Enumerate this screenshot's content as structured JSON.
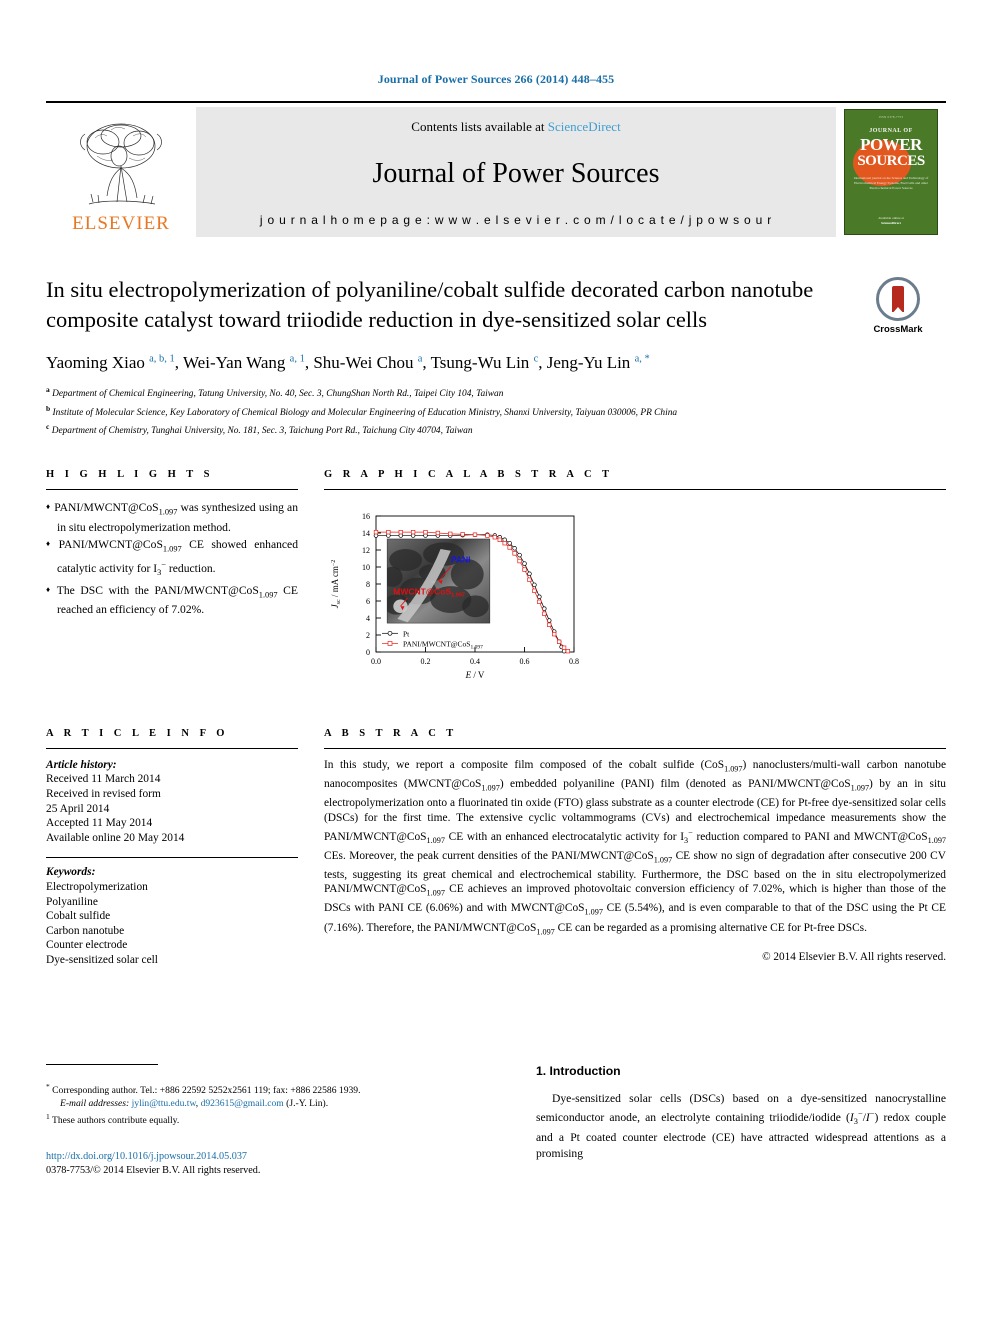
{
  "journal_ref": "Journal of Power Sources 266 (2014) 448–455",
  "masthead": {
    "contents_prefix": "Contents lists available at ",
    "sciencedirect": "ScienceDirect",
    "journal_title": "Journal of Power Sources",
    "homepage": "j o u r n a l   h o m e p a g e :   w w w . e l s e v i e r . c o m / l o c a t e / j p o w s o u r",
    "publisher": "ELSEVIER",
    "cover": {
      "top_line": "ISSN 0378-7753",
      "journal_of": "JOURNAL OF",
      "power": "POWER",
      "sources": "SOURCES",
      "blurb": "International journal on the Science and Technology of Electrochemical Energy Systems, Fuel Cells and other Electrochemical Power Sources",
      "bottom_small": "Available online at",
      "bottom_brand": "ScienceDirect"
    }
  },
  "article": {
    "title": "In situ electropolymerization of polyaniline/cobalt sulfide decorated carbon nanotube composite catalyst toward triiodide reduction in dye-sensitized solar cells",
    "crossmark_label": "CrossMark",
    "authors_html": "Yaoming Xiao <sup>a, b, 1</sup>, Wei-Yan Wang <sup>a, 1</sup>, Shu-Wei Chou <sup>a</sup>, Tsung-Wu Lin <sup>c</sup>, Jeng-Yu Lin <sup>a, <span class=\"blk\">*</span></sup>",
    "affiliations": [
      {
        "marker": "a",
        "text": "Department of Chemical Engineering, Tatung University, No. 40, Sec. 3, ChungShan North Rd., Taipei City 104, Taiwan"
      },
      {
        "marker": "b",
        "text": "Institute of Molecular Science, Key Laboratory of Chemical Biology and Molecular Engineering of Education Ministry, Shanxi University, Taiyuan 030006, PR China"
      },
      {
        "marker": "c",
        "text": "Department of Chemistry, Tunghai University, No. 181, Sec. 3, Taichung Port Rd., Taichung City 40704, Taiwan"
      }
    ]
  },
  "highlights": {
    "heading": "H I G H L I G H T S",
    "items": [
      "PANI/MWCNT@CoS<sub>1.097</sub> was synthesized using an in situ electropolymerization method.",
      "PANI/MWCNT@CoS<sub>1.097</sub> CE showed enhanced catalytic activity for I<sub>3</sub><sup class=\"ovl\">&#8722;</sup> reduction.",
      "The DSC with the PANI/MWCNT@CoS<sub>1.097</sub> CE reached an efficiency of 7.02%."
    ]
  },
  "graphical_abstract": {
    "heading": "G R A P H I C A L   A B S T R A C T",
    "inset_labels": {
      "pani": "PANI",
      "mwcnt": "MWCNT@CoS",
      "mwcnt_sub": "1.097"
    }
  },
  "chart_data": {
    "type": "line",
    "title": "",
    "xlabel": "E / V",
    "ylabel": "J_sc / mA cm^-2",
    "xlim": [
      0.0,
      0.8
    ],
    "ylim": [
      0,
      16
    ],
    "xticks": [
      "0.0",
      "0.2",
      "0.4",
      "0.6",
      "0.8"
    ],
    "yticks": [
      "0",
      "2",
      "4",
      "6",
      "8",
      "10",
      "12",
      "14",
      "16"
    ],
    "grid": false,
    "legend_position": "lower-left",
    "series": [
      {
        "name": "Pt",
        "color": "#000000",
        "marker": "circle-open",
        "x": [
          0.0,
          0.05,
          0.1,
          0.15,
          0.2,
          0.25,
          0.3,
          0.35,
          0.4,
          0.45,
          0.48,
          0.5,
          0.52,
          0.54,
          0.56,
          0.58,
          0.6,
          0.62,
          0.64,
          0.66,
          0.68,
          0.7,
          0.72,
          0.74,
          0.75,
          0.76
        ],
        "y": [
          13.7,
          13.7,
          13.7,
          13.7,
          13.7,
          13.7,
          13.7,
          13.75,
          13.8,
          13.8,
          13.7,
          13.5,
          13.2,
          12.8,
          12.2,
          11.4,
          10.4,
          9.2,
          7.9,
          6.5,
          5.1,
          3.7,
          2.4,
          1.2,
          0.6,
          0.1
        ]
      },
      {
        "name": "PANI/MWCNT@CoS1.097",
        "color": "#e8201a",
        "marker": "square-open",
        "x": [
          0.0,
          0.05,
          0.1,
          0.15,
          0.2,
          0.25,
          0.3,
          0.35,
          0.4,
          0.45,
          0.48,
          0.5,
          0.52,
          0.54,
          0.56,
          0.58,
          0.6,
          0.62,
          0.64,
          0.66,
          0.68,
          0.7,
          0.72,
          0.74,
          0.76,
          0.775
        ],
        "y": [
          14.1,
          14.1,
          14.1,
          14.1,
          14.1,
          14.0,
          13.9,
          13.85,
          13.8,
          13.7,
          13.5,
          13.2,
          12.8,
          12.3,
          11.6,
          10.7,
          9.7,
          8.5,
          7.2,
          5.9,
          4.5,
          3.2,
          2.1,
          1.2,
          0.5,
          0.1
        ]
      }
    ],
    "legend": [
      "Pt",
      "PANI/MWCNT@CoS1.097"
    ]
  },
  "article_info": {
    "heading": "A R T I C L E   I N F O",
    "history_label": "Article history:",
    "history": [
      "Received 11 March 2014",
      "Received in revised form",
      "25 April 2014",
      "Accepted 11 May 2014",
      "Available online 20 May 2014"
    ],
    "keywords_label": "Keywords:",
    "keywords": [
      "Electropolymerization",
      "Polyaniline",
      "Cobalt sulfide",
      "Carbon nanotube",
      "Counter electrode",
      "Dye-sensitized solar cell"
    ]
  },
  "abstract": {
    "heading": "A B S T R A C T",
    "text_html": "In this study, we report a composite film composed of the cobalt sulfide (CoS<sub>1.097</sub>) nanoclusters/multi-wall carbon nanotube nanocomposites (MWCNT@CoS<sub>1.097</sub>) embedded polyaniline (PANI) film (denoted as PANI/MWCNT@CoS<sub>1.097</sub>) by an in situ electropolymerization onto a fluorinated tin oxide (FTO) glass substrate as a counter electrode (CE) for Pt-free dye-sensitized solar cells (DSCs) for the first time. The extensive cyclic voltammograms (CVs) and electrochemical impedance measurements show the PANI/MWCNT@CoS<sub>1.097</sub> CE with an enhanced electrocatalytic activity for I<sub>3</sub><sup class=\"ovl\">&#8722;</sup> reduction compared to PANI and MWCNT@CoS<sub>1.097</sub> CEs. Moreover, the peak current densities of the PANI/MWCNT@CoS<sub>1.097</sub> CE show no sign of degradation after consecutive 200 CV tests, suggesting its great chemical and electrochemical stability. Furthermore, the DSC based on the in situ electropolymerized PANI/MWCNT@CoS<sub>1.097</sub> CE achieves an improved photovoltaic conversion efficiency of 7.02%, which is higher than those of the DSCs with PANI CE (6.06%) and with MWCNT@CoS<sub>1.097</sub> CE (5.54%), and is even comparable to that of the DSC using the Pt CE (7.16%). Therefore, the PANI/MWCNT@CoS<sub>1.097</sub> CE can be regarded as a promising alternative CE for Pt-free DSCs.",
    "copyright": "© 2014 Elsevier B.V. All rights reserved."
  },
  "footer": {
    "corresponding_html": "<sup>*</sup> Corresponding author. Tel.: +886 22592 5252x2561 119; fax: +886 22586 1939.",
    "email_label": "E-mail addresses:",
    "email1": "jylin@ttu.edu.tw",
    "email2": "d923615@gmail.com",
    "email_suffix": "(J.-Y. Lin).",
    "equal_contrib_html": "<sup>1</sup> These authors contribute equally.",
    "doi": "http://dx.doi.org/10.1016/j.jpowsour.2014.05.037",
    "issn_line": "0378-7753/© 2014 Elsevier B.V. All rights reserved."
  },
  "introduction": {
    "heading": "1.  Introduction",
    "paragraph_html": "Dye-sensitized solar cells (DSCs) based on a dye-sensitized nanocrystalline semiconductor anode, an electrolyte containing triiodide/iodide (<i>I</i><sub>3</sub><sup class=\"ovl\">&#8722;</sup>/<i>I</i><sup class=\"ovl\">&#8722;</sup>) redox couple and a Pt coated counter electrode (CE) have attracted widespread attentions as a promising"
  }
}
